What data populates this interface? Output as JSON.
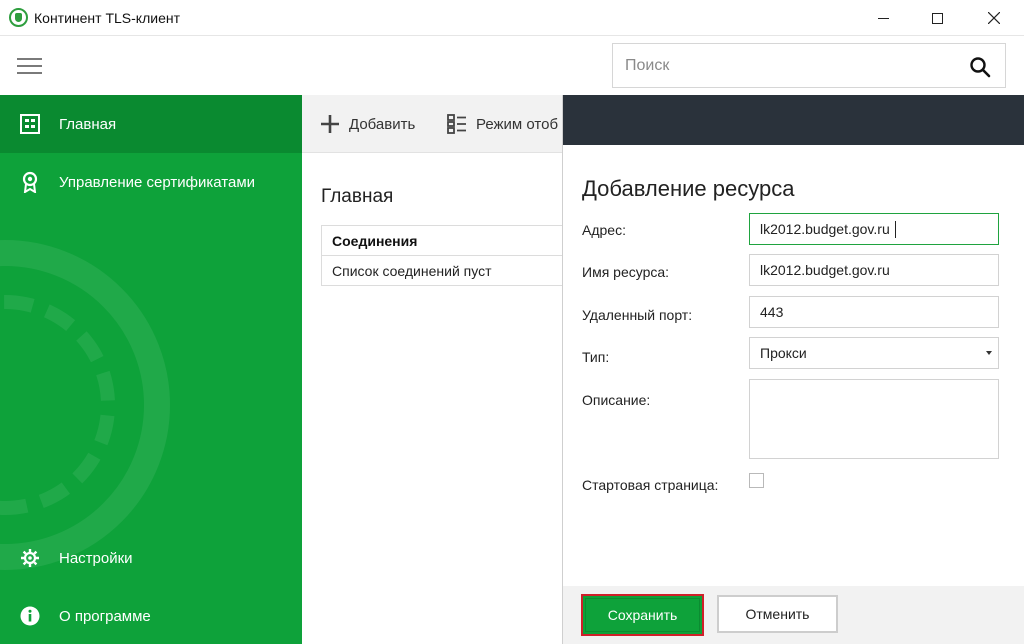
{
  "window": {
    "title": "Континент TLS-клиент",
    "app_icon": "continent-logo-icon",
    "minimize_icon": "minimize-icon",
    "maximize_icon": "maximize-icon",
    "close_icon": "close-icon"
  },
  "search": {
    "placeholder": "Поиск",
    "value": "",
    "icon": "search-icon"
  },
  "sidebar": {
    "menu_icon": "hamburger-icon",
    "items": [
      {
        "label": "Главная",
        "icon": "home-grid-icon",
        "active": true
      },
      {
        "label": "Управление сертификатами",
        "icon": "certificate-badge-icon",
        "active": false
      },
      {
        "label": "Настройки",
        "icon": "gear-icon",
        "active": false
      },
      {
        "label": "О программе",
        "icon": "info-icon",
        "active": false
      }
    ]
  },
  "main": {
    "toolbar": {
      "add_label": "Добавить",
      "view_mode_label": "Режим отоб"
    },
    "title": "Главная",
    "table": {
      "header": "Соединения",
      "empty_text": "Список соединений пуст"
    }
  },
  "panel": {
    "title": "Добавление ресурса",
    "fields": {
      "address": {
        "label": "Адрес:",
        "value": "lk2012.budget.gov.ru"
      },
      "resource_name": {
        "label": "Имя ресурса:",
        "value": "lk2012.budget.gov.ru"
      },
      "remote_port": {
        "label": "Удаленный порт:",
        "value": "443"
      },
      "type": {
        "label": "Тип:",
        "value": "Прокси"
      },
      "description": {
        "label": "Описание:",
        "value": ""
      },
      "start_page": {
        "label": "Стартовая страница:",
        "checked": false
      }
    },
    "buttons": {
      "save": "Сохранить",
      "cancel": "Отменить"
    }
  },
  "colors": {
    "sidebar_green": "#0ea23a",
    "sidebar_active": "#0a8a30",
    "panel_header_dark": "#2a323b",
    "save_highlight_red": "#d0202a",
    "focus_green": "#1fa33f"
  }
}
